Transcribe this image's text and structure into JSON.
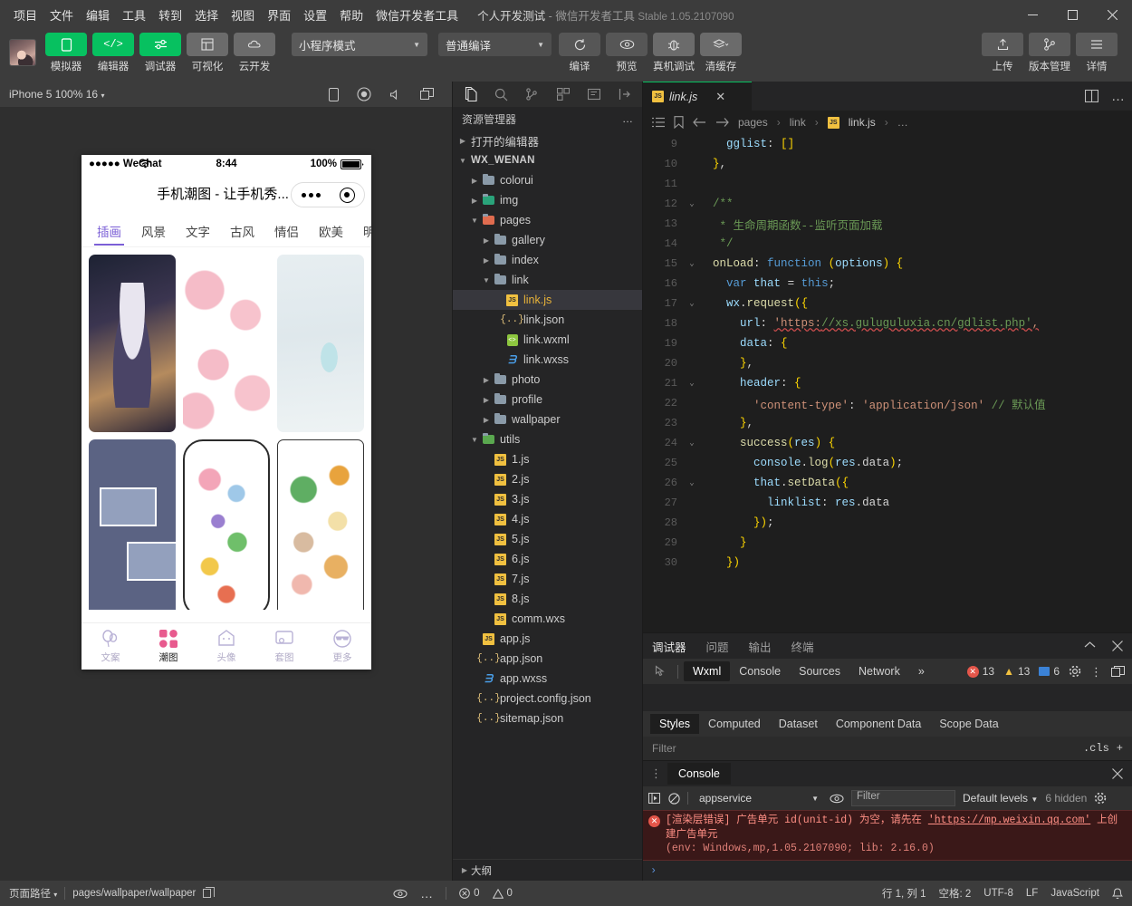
{
  "menu": {
    "items": [
      "项目",
      "文件",
      "编辑",
      "工具",
      "转到",
      "选择",
      "视图",
      "界面",
      "设置",
      "帮助",
      "微信开发者工具"
    ],
    "window_title_project": "个人开发测试",
    "window_title_sep": "-",
    "window_title_app": "微信开发者工具",
    "window_title_version": "Stable 1.05.2107090",
    "minimize": "−",
    "maximize": "▢",
    "close": "✕"
  },
  "toolbar": {
    "buttons": [
      {
        "label": "模拟器",
        "icon": "phone-icon",
        "style": "green"
      },
      {
        "label": "编辑器",
        "icon": "code-icon",
        "style": "green"
      },
      {
        "label": "调试器",
        "icon": "debug-sliders-icon",
        "style": "green"
      },
      {
        "label": "可视化",
        "icon": "layout-icon",
        "style": "grey"
      },
      {
        "label": "云开发",
        "icon": "cloud-icon",
        "style": "grey"
      }
    ],
    "mode_select": "小程序模式",
    "compile_select": "普通编译",
    "actions": [
      {
        "label": "编译",
        "icon": "refresh-icon"
      },
      {
        "label": "预览",
        "icon": "eye-icon"
      },
      {
        "label": "真机调试",
        "icon": "bug-icon"
      },
      {
        "label": "清缓存",
        "icon": "layers-icon"
      }
    ],
    "right_actions": [
      {
        "label": "上传",
        "icon": "upload-icon"
      },
      {
        "label": "版本管理",
        "icon": "branch-icon"
      },
      {
        "label": "详情",
        "icon": "menu-lines-icon"
      }
    ]
  },
  "simulator": {
    "device_label": "iPhone 5 100% 16",
    "toolbar_icons": [
      "device-rotate-icon",
      "record-icon",
      "volume-icon",
      "window-icon"
    ],
    "phone": {
      "carrier": "●●●●● WeChat",
      "wifi": "WiFi",
      "time": "8:44",
      "battery_pct": "100%",
      "nav_title": "手机潮图 - 让手机秀...",
      "capsule_more": "•••",
      "capsule_close": "◉",
      "category_tabs": [
        "插画",
        "风景",
        "文字",
        "古风",
        "情侣",
        "欧美",
        "明星"
      ],
      "active_category": "插画",
      "thumbnails": [
        {
          "name": "anime-girl-wallpaper"
        },
        {
          "name": "pink-cinnamoroll-pattern"
        },
        {
          "name": "pastel-gradient-wallpaper"
        },
        {
          "name": "blue-photo-collage"
        },
        {
          "name": "doodle-sticker-wallpaper"
        },
        {
          "name": "cute-animal-sticker-sheet"
        }
      ],
      "tabbar": [
        {
          "label": "文案",
          "icon": "balloon-icon",
          "active": false
        },
        {
          "label": "潮图",
          "icon": "grid-icon",
          "active": true
        },
        {
          "label": "头像",
          "icon": "ghost-icon",
          "active": false
        },
        {
          "label": "套图",
          "icon": "frame-icon",
          "active": false
        },
        {
          "label": "更多",
          "icon": "sunglasses-icon",
          "active": false
        }
      ]
    }
  },
  "explorer": {
    "activity_icons": [
      "files-icon",
      "search-icon",
      "source-control-icon",
      "extensions-icon",
      "notes-icon",
      "collapse-icon"
    ],
    "title": "资源管理器",
    "more": "…",
    "outline_label": "大纲",
    "tree": [
      {
        "label": "打开的编辑器",
        "depth": 0,
        "arrow": "right",
        "icon": "none",
        "bold": false
      },
      {
        "label": "WX_WENAN",
        "depth": 0,
        "arrow": "down",
        "icon": "none",
        "bold": true
      },
      {
        "label": "colorui",
        "depth": 1,
        "arrow": "right",
        "icon": "folder"
      },
      {
        "label": "img",
        "depth": 1,
        "arrow": "right",
        "icon": "folder-teal"
      },
      {
        "label": "pages",
        "depth": 1,
        "arrow": "down",
        "icon": "folder-red"
      },
      {
        "label": "gallery",
        "depth": 2,
        "arrow": "right",
        "icon": "folder"
      },
      {
        "label": "index",
        "depth": 2,
        "arrow": "right",
        "icon": "folder"
      },
      {
        "label": "link",
        "depth": 2,
        "arrow": "down",
        "icon": "folder-open"
      },
      {
        "label": "link.js",
        "depth": 3,
        "arrow": "none",
        "icon": "js",
        "selected": true
      },
      {
        "label": "link.json",
        "depth": 3,
        "arrow": "none",
        "icon": "json"
      },
      {
        "label": "link.wxml",
        "depth": 3,
        "arrow": "none",
        "icon": "wxml"
      },
      {
        "label": "link.wxss",
        "depth": 3,
        "arrow": "none",
        "icon": "wxss"
      },
      {
        "label": "photo",
        "depth": 2,
        "arrow": "right",
        "icon": "folder"
      },
      {
        "label": "profile",
        "depth": 2,
        "arrow": "right",
        "icon": "folder"
      },
      {
        "label": "wallpaper",
        "depth": 2,
        "arrow": "right",
        "icon": "folder"
      },
      {
        "label": "utils",
        "depth": 1,
        "arrow": "down",
        "icon": "folder-green"
      },
      {
        "label": "1.js",
        "depth": 2,
        "arrow": "none",
        "icon": "js"
      },
      {
        "label": "2.js",
        "depth": 2,
        "arrow": "none",
        "icon": "js"
      },
      {
        "label": "3.js",
        "depth": 2,
        "arrow": "none",
        "icon": "js"
      },
      {
        "label": "4.js",
        "depth": 2,
        "arrow": "none",
        "icon": "js"
      },
      {
        "label": "5.js",
        "depth": 2,
        "arrow": "none",
        "icon": "js"
      },
      {
        "label": "6.js",
        "depth": 2,
        "arrow": "none",
        "icon": "js"
      },
      {
        "label": "7.js",
        "depth": 2,
        "arrow": "none",
        "icon": "js"
      },
      {
        "label": "8.js",
        "depth": 2,
        "arrow": "none",
        "icon": "js"
      },
      {
        "label": "comm.wxs",
        "depth": 2,
        "arrow": "none",
        "icon": "js"
      },
      {
        "label": "app.js",
        "depth": 1,
        "arrow": "none",
        "icon": "js"
      },
      {
        "label": "app.json",
        "depth": 1,
        "arrow": "none",
        "icon": "json"
      },
      {
        "label": "app.wxss",
        "depth": 1,
        "arrow": "none",
        "icon": "wxss"
      },
      {
        "label": "project.config.json",
        "depth": 1,
        "arrow": "none",
        "icon": "json"
      },
      {
        "label": "sitemap.json",
        "depth": 1,
        "arrow": "none",
        "icon": "json"
      }
    ]
  },
  "editor": {
    "tab": {
      "label": "link.js",
      "icon": "js-icon",
      "close": "✕"
    },
    "tab_right_icons": [
      "split-editor-icon",
      "more-icon"
    ],
    "breadcrumb_icons": [
      "outline-list-icon",
      "bookmark-icon",
      "back-arrow-icon",
      "forward-arrow-icon"
    ],
    "breadcrumb": [
      "pages",
      "link",
      "link.js",
      "…"
    ],
    "lines": [
      {
        "n": "9",
        "fold": "",
        "code": "    gglist: []"
      },
      {
        "n": "10",
        "fold": "",
        "code": "  },"
      },
      {
        "n": "11",
        "fold": "",
        "code": ""
      },
      {
        "n": "12",
        "fold": "v",
        "code": "  /**"
      },
      {
        "n": "13",
        "fold": "",
        "code": "   * 生命周期函数--监听页面加载"
      },
      {
        "n": "14",
        "fold": "",
        "code": "   */"
      },
      {
        "n": "15",
        "fold": "v",
        "code": "  onLoad: function (options) {"
      },
      {
        "n": "16",
        "fold": "",
        "code": "    var that = this;"
      },
      {
        "n": "17",
        "fold": "v",
        "code": "    wx.request({"
      },
      {
        "n": "18",
        "fold": "",
        "code": "      url: 'https://xs.guluguluxia.cn/gdlist.php',"
      },
      {
        "n": "19",
        "fold": "",
        "code": "      data: {"
      },
      {
        "n": "20",
        "fold": "",
        "code": "      },"
      },
      {
        "n": "21",
        "fold": "v",
        "code": "      header: {"
      },
      {
        "n": "22",
        "fold": "",
        "code": "        'content-type': 'application/json' // 默认值"
      },
      {
        "n": "23",
        "fold": "",
        "code": "      },"
      },
      {
        "n": "24",
        "fold": "v",
        "code": "      success(res) {"
      },
      {
        "n": "25",
        "fold": "",
        "code": "        console.log(res.data);"
      },
      {
        "n": "26",
        "fold": "v",
        "code": "        that.setData({"
      },
      {
        "n": "27",
        "fold": "",
        "code": "          linklist: res.data"
      },
      {
        "n": "28",
        "fold": "",
        "code": "        });"
      },
      {
        "n": "29",
        "fold": "",
        "code": "      }"
      },
      {
        "n": "30",
        "fold": "",
        "code": "    })"
      }
    ]
  },
  "debugger": {
    "panel_tabs": [
      "调试器",
      "问题",
      "输出",
      "终端"
    ],
    "active_panel_tab": "调试器",
    "collapse_icon": "chevron-up-icon",
    "close_icon": "close-icon",
    "devtool_tabs": [
      "Wxml",
      "Console",
      "Sources",
      "Network"
    ],
    "active_devtool_tab": "Wxml",
    "overflow": "»",
    "inspect_icon": "inspect-icon",
    "errors": "13",
    "warnings": "13",
    "infos": "6",
    "settings_icon": "gear-icon",
    "kebab_icon": "more-vertical-icon",
    "dock_icon": "dock-icon",
    "style_tabs": [
      "Styles",
      "Computed",
      "Dataset",
      "Component Data",
      "Scope Data"
    ],
    "active_style_tab": "Styles",
    "filter_placeholder": "Filter",
    "cls_label": ".cls",
    "add_label": "+"
  },
  "console": {
    "tab_label": "Console",
    "drag_icon": "drag-dots-icon",
    "close_icon": "close-icon",
    "play_icon": "step-icon",
    "clear_icon": "clear-icon",
    "context": "appservice",
    "eye_icon": "eye-icon",
    "filter_placeholder": "Filter",
    "levels": "Default levels",
    "hidden": "6 hidden",
    "settings_icon": "gear-icon",
    "message": {
      "prefix": "[渲染层错误] 广告单元 id(unit-id) 为空，请先在 ",
      "link": "'https://mp.weixin.qq.com'",
      "suffix": " 上创建广告单元",
      "env": "(env: Windows,mp,1.05.2107090; lib: 2.16.0)"
    },
    "prompt": "›"
  },
  "statusbar": {
    "page_path_label": "页面路径",
    "page_path_value": "pages/wallpaper/wallpaper",
    "copy_icon": "copy-icon",
    "eye_icon": "eye-icon",
    "more_icon": "more-icon",
    "errors": "0",
    "warnings": "0",
    "line_col": "行 1, 列 1",
    "spaces": "空格: 2",
    "encoding": "UTF-8",
    "eol": "LF",
    "language": "JavaScript",
    "bell_icon": "bell-icon"
  },
  "colors": {
    "accent_green": "#07c160",
    "error_red": "#e4564a",
    "warning_yellow": "#f0c040",
    "purple_tab": "#7b5fd6"
  }
}
